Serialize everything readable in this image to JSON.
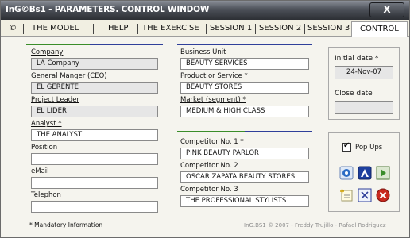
{
  "window": {
    "title": "InG©Bs1 - PARAMETERS. CONTROL WINDOW",
    "close_glyph": "X"
  },
  "tabs": [
    {
      "label": "©"
    },
    {
      "label": "THE MODEL"
    },
    {
      "label": "HELP"
    },
    {
      "label": "THE EXERCISE"
    },
    {
      "label": "SESSION 1"
    },
    {
      "label": "SESSION 2"
    },
    {
      "label": "SESSION 3"
    },
    {
      "label": "CONTROL"
    }
  ],
  "active_tab": "CONTROL",
  "left": {
    "company_label": "Company",
    "company_value": "LA Company",
    "gm_label": "General Manger (CEO)",
    "gm_value": "EL GERENTE",
    "pl_label": "Project Leader",
    "pl_value": "EL LIDER",
    "analyst_label": "Analyst *",
    "analyst_value": "THE ANALYST",
    "position_label": "Position",
    "position_value": "",
    "email_label": "eMail",
    "email_value": "",
    "telephon_label": "Telephon",
    "telephon_value": ""
  },
  "middle": {
    "bu_label": "Business Unit",
    "bu_value": "BEAUTY SERVICES",
    "ps_label": "Product or Service *",
    "ps_value": "BEAUTY STORES",
    "market_label": "Market (segment) *",
    "market_value": "MEDIUM & HIGH CLASS",
    "comp1_label": "Competitor No. 1 *",
    "comp1_value": "PINK BEAUTY PARLOR",
    "comp2_label": "Competitor No. 2",
    "comp2_value": "OSCAR ZAPATA BEAUTY STORES",
    "comp3_label": "Competitor No. 3",
    "comp3_value": "THE PROFESSIONAL STYLISTS"
  },
  "right": {
    "initial_label": "Initial date *",
    "initial_value": "24-Nov-07",
    "close_label": "Close date",
    "close_value": "",
    "popups_label": "Pop Ups",
    "popups_checked": true,
    "check_mark": "✔"
  },
  "footer": {
    "mandatory": "* Mandatory Information",
    "credit": "InG.BS1 © 2007 - Freddy Trujillo - Rafael Rodriguez"
  },
  "colors": {
    "left_rule": "#3a8d2a",
    "mid_rule_a": "#2f3f9a",
    "mid_rule_b": "#3a8d2a"
  },
  "icons": [
    "settings-icon",
    "info-icon",
    "next-icon",
    "edit-icon",
    "clear-icon",
    "exit-icon"
  ]
}
